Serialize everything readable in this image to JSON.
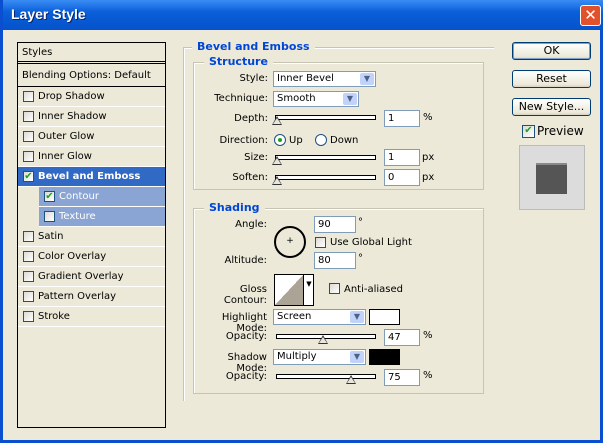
{
  "window": {
    "title": "Layer Style",
    "close_icon": "close-icon"
  },
  "styles_list": {
    "header": "Styles",
    "blending": "Blending Options: Default",
    "items": [
      {
        "label": "Drop Shadow",
        "checked": false
      },
      {
        "label": "Inner Shadow",
        "checked": false
      },
      {
        "label": "Outer Glow",
        "checked": false
      },
      {
        "label": "Inner Glow",
        "checked": false
      },
      {
        "label": "Bevel and Emboss",
        "checked": true,
        "selected": true
      },
      {
        "label": "Contour",
        "checked": true,
        "sub": true
      },
      {
        "label": "Texture",
        "checked": false,
        "sub": true
      },
      {
        "label": "Satin",
        "checked": false
      },
      {
        "label": "Color Overlay",
        "checked": false
      },
      {
        "label": "Gradient Overlay",
        "checked": false
      },
      {
        "label": "Pattern Overlay",
        "checked": false
      },
      {
        "label": "Stroke",
        "checked": false
      }
    ]
  },
  "bevel": {
    "title": "Bevel and Emboss",
    "structure": {
      "title": "Structure",
      "style_label": "Style:",
      "style_value": "Inner Bevel",
      "technique_label": "Technique:",
      "technique_value": "Smooth",
      "depth_label": "Depth:",
      "depth_value": "1",
      "depth_unit": "%",
      "direction_label": "Direction:",
      "up": "Up",
      "down": "Down",
      "direction_selected": "Up",
      "size_label": "Size:",
      "size_value": "1",
      "size_unit": "px",
      "soften_label": "Soften:",
      "soften_value": "0",
      "soften_unit": "px"
    },
    "shading": {
      "title": "Shading",
      "angle_label": "Angle:",
      "angle_value": "90",
      "degree": "°",
      "global_light": "Use Global Light",
      "altitude_label": "Altitude:",
      "altitude_value": "80",
      "gloss_label": "Gloss Contour:",
      "anti_aliased": "Anti-aliased",
      "highlight_label": "Highlight Mode:",
      "highlight_mode": "Screen",
      "highlight_color": "#ffffff",
      "opacity_label": "Opacity:",
      "highlight_opacity": "47",
      "pct": "%",
      "shadow_label": "Shadow Mode:",
      "shadow_mode": "Multiply",
      "shadow_color": "#000000",
      "shadow_opacity": "75"
    }
  },
  "buttons": {
    "ok": "OK",
    "reset": "Reset",
    "new_style": "New Style...",
    "preview": "Preview",
    "preview_checked": true
  }
}
